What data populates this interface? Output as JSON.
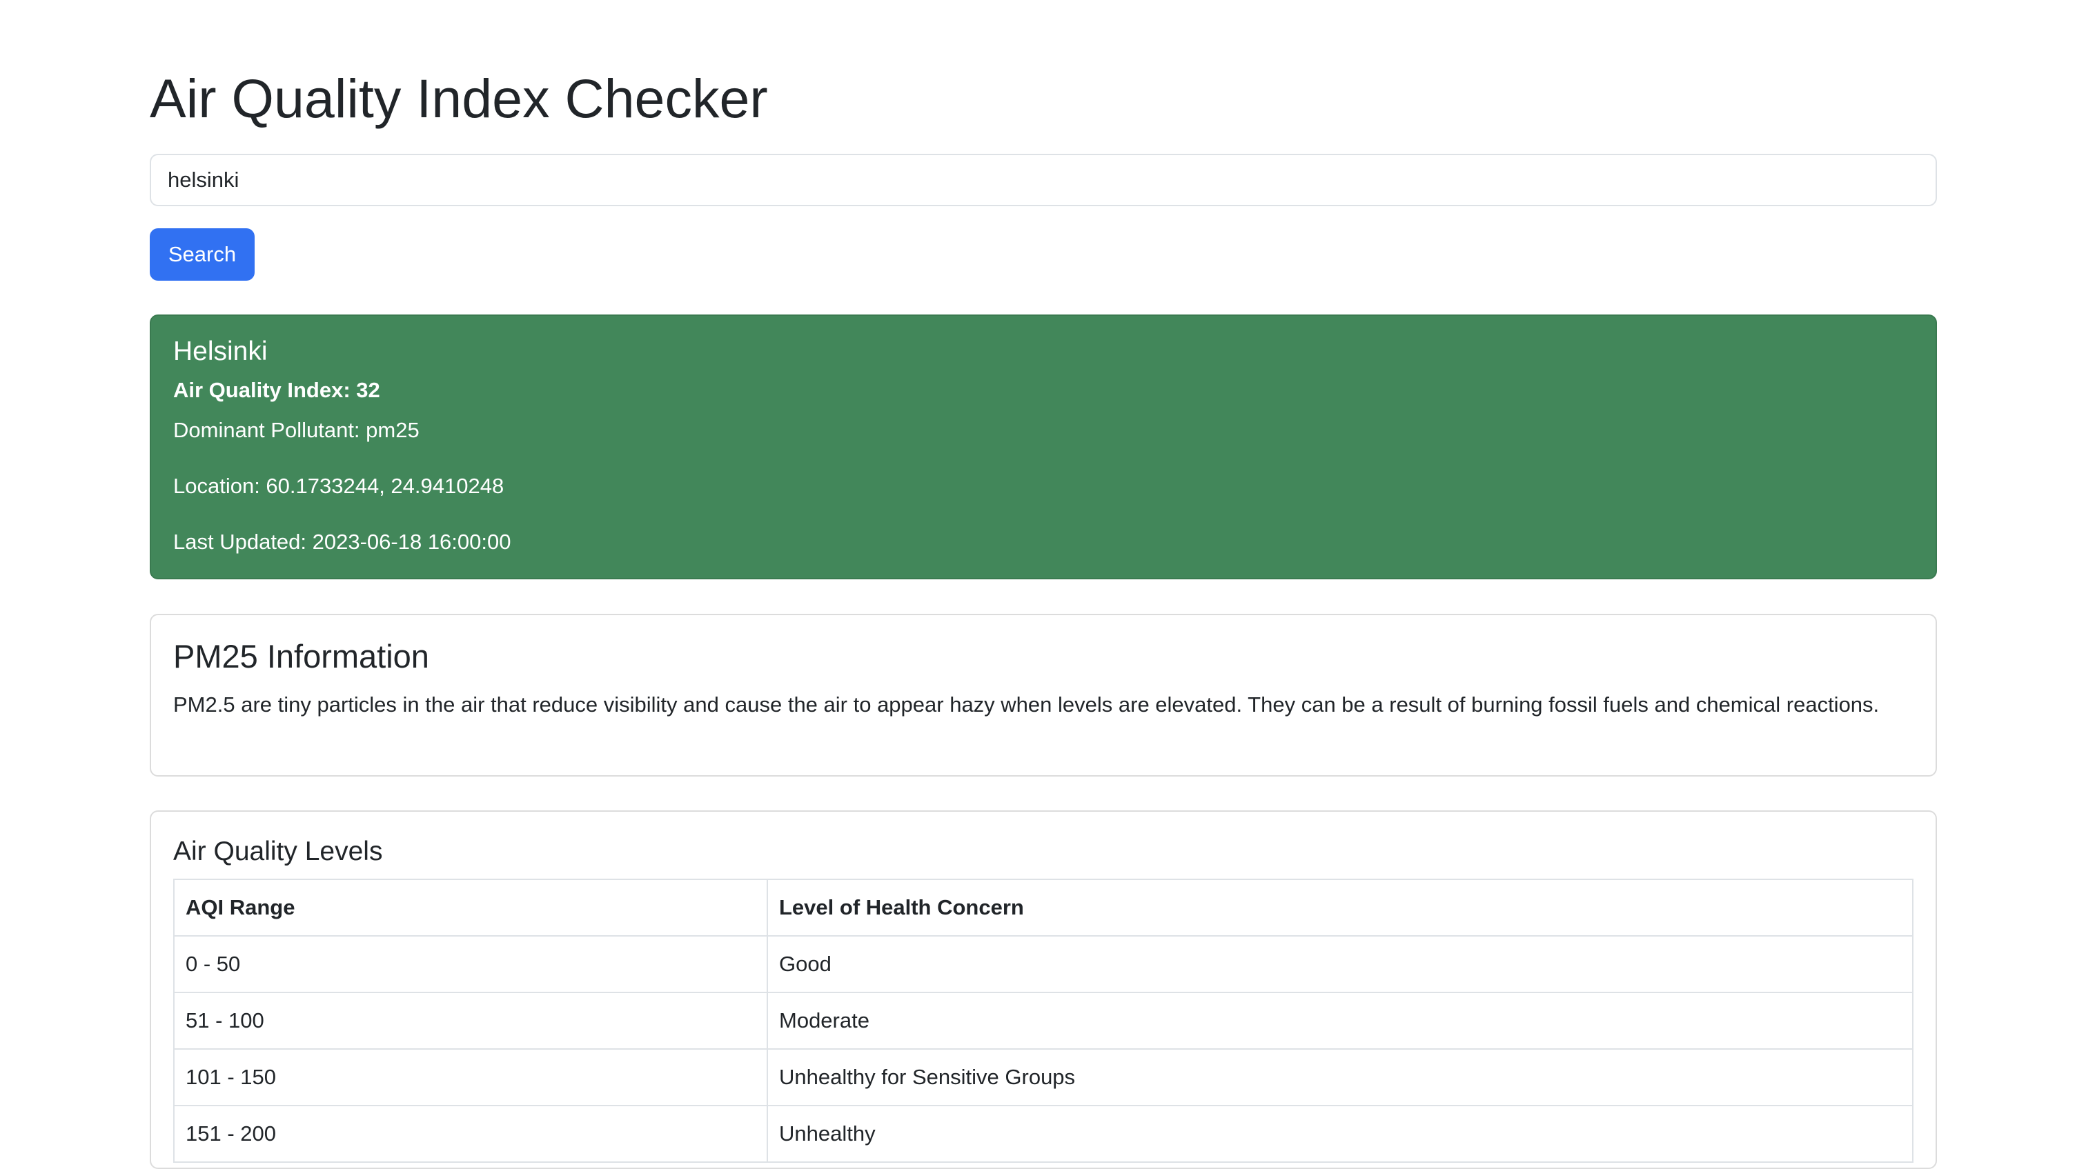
{
  "page": {
    "title": "Air Quality Index Checker"
  },
  "search": {
    "value": "helsinki",
    "placeholder": "",
    "button_label": "Search"
  },
  "result": {
    "city": "Helsinki",
    "aqi": "Air Quality Index: 32",
    "dominant_pollutant": "Dominant Pollutant: pm25",
    "location": "Location: 60.1733244, 24.9410248",
    "last_updated": "Last Updated: 2023-06-18 16:00:00",
    "background_color": "#42875a"
  },
  "pollutant_info": {
    "title": "PM25 Information",
    "description": "PM2.5 are tiny particles in the air that reduce visibility and cause the air to appear hazy when levels are elevated. They can be a result of burning fossil fuels and chemical reactions."
  },
  "levels": {
    "title": "Air Quality Levels",
    "headers": [
      "AQI Range",
      "Level of Health Concern"
    ],
    "rows": [
      [
        "0 - 50",
        "Good"
      ],
      [
        "51 - 100",
        "Moderate"
      ],
      [
        "101 - 150",
        "Unhealthy for Sensitive Groups"
      ],
      [
        "151 - 200",
        "Unhealthy"
      ]
    ]
  },
  "colors": {
    "primary_button": "#3171f2",
    "text": "#212529",
    "border": "#dee2e6"
  }
}
